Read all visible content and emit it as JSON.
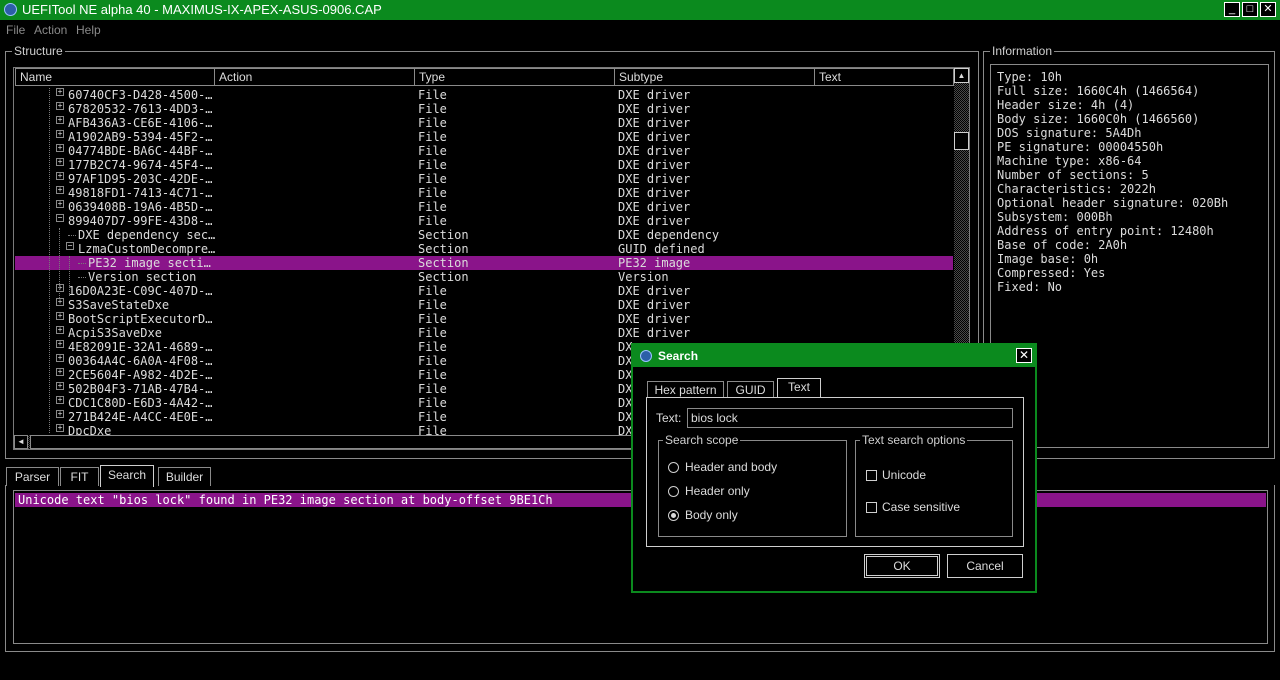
{
  "window": {
    "title": "UEFITool NE alpha 40 - MAXIMUS-IX-APEX-ASUS-0906.CAP",
    "minimize": "_",
    "maximize": "□",
    "close": "✕"
  },
  "menu": [
    "File",
    "Action",
    "Help"
  ],
  "structure": {
    "title": "Structure",
    "columns": [
      "Name",
      "Action",
      "Type",
      "Subtype",
      "Text"
    ],
    "rows": [
      {
        "name": "60740CF3-D428-4500-…",
        "type": "File",
        "subtype": "DXE driver",
        "level": 1,
        "expander": "+"
      },
      {
        "name": "67820532-7613-4DD3-…",
        "type": "File",
        "subtype": "DXE driver",
        "level": 1,
        "expander": "+"
      },
      {
        "name": "AFB436A3-CE6E-4106-…",
        "type": "File",
        "subtype": "DXE driver",
        "level": 1,
        "expander": "+"
      },
      {
        "name": "A1902AB9-5394-45F2-…",
        "type": "File",
        "subtype": "DXE driver",
        "level": 1,
        "expander": "+"
      },
      {
        "name": "04774BDE-BA6C-44BF-…",
        "type": "File",
        "subtype": "DXE driver",
        "level": 1,
        "expander": "+"
      },
      {
        "name": "177B2C74-9674-45F4-…",
        "type": "File",
        "subtype": "DXE driver",
        "level": 1,
        "expander": "+"
      },
      {
        "name": "97AF1D95-203C-42DE-…",
        "type": "File",
        "subtype": "DXE driver",
        "level": 1,
        "expander": "+"
      },
      {
        "name": "49818FD1-7413-4C71-…",
        "type": "File",
        "subtype": "DXE driver",
        "level": 1,
        "expander": "+"
      },
      {
        "name": "0639408B-19A6-4B5D-…",
        "type": "File",
        "subtype": "DXE driver",
        "level": 1,
        "expander": "+"
      },
      {
        "name": "899407D7-99FE-43D8-…",
        "type": "File",
        "subtype": "DXE driver",
        "level": 1,
        "expander": "-"
      },
      {
        "name": "DXE dependency sec…",
        "type": "Section",
        "subtype": "DXE dependency",
        "level": 2,
        "expander": ""
      },
      {
        "name": "LzmaCustomDecompre…",
        "type": "Section",
        "subtype": "GUID defined",
        "level": 2,
        "expander": "-"
      },
      {
        "name": "PE32 image secti…",
        "type": "Section",
        "subtype": "PE32 image",
        "level": 3,
        "expander": "",
        "selected": true
      },
      {
        "name": "Version section",
        "type": "Section",
        "subtype": "Version",
        "level": 3,
        "expander": ""
      },
      {
        "name": "16D0A23E-C09C-407D-…",
        "type": "File",
        "subtype": "DXE driver",
        "level": 1,
        "expander": "+"
      },
      {
        "name": "S3SaveStateDxe",
        "type": "File",
        "subtype": "DXE driver",
        "level": 1,
        "expander": "+"
      },
      {
        "name": "BootScriptExecutorD…",
        "type": "File",
        "subtype": "DXE driver",
        "level": 1,
        "expander": "+"
      },
      {
        "name": "AcpiS3SaveDxe",
        "type": "File",
        "subtype": "DXE driver",
        "level": 1,
        "expander": "+"
      },
      {
        "name": "4E82091E-32A1-4689-…",
        "type": "File",
        "subtype": "DX",
        "level": 1,
        "expander": "+"
      },
      {
        "name": "00364A4C-6A0A-4F08-…",
        "type": "File",
        "subtype": "DX",
        "level": 1,
        "expander": "+"
      },
      {
        "name": "2CE5604F-A982-4D2E-…",
        "type": "File",
        "subtype": "DX",
        "level": 1,
        "expander": "+"
      },
      {
        "name": "502B04F3-71AB-47B4-…",
        "type": "File",
        "subtype": "DX",
        "level": 1,
        "expander": "+"
      },
      {
        "name": "CDC1C80D-E6D3-4A42-…",
        "type": "File",
        "subtype": "DX",
        "level": 1,
        "expander": "+"
      },
      {
        "name": "271B424E-A4CC-4E0E-…",
        "type": "File",
        "subtype": "DX",
        "level": 1,
        "expander": "+"
      },
      {
        "name": "DpcDxe",
        "type": "File",
        "subtype": "DX",
        "level": 1,
        "expander": "+"
      }
    ],
    "scroll_up": "▲",
    "scroll_left": "◄"
  },
  "information": {
    "title": "Information",
    "lines": [
      "Type: 10h",
      "Full size: 1660C4h (1466564)",
      "Header size: 4h (4)",
      "Body size: 1660C0h (1466560)",
      "DOS signature: 5A4Dh",
      "PE signature: 00004550h",
      "Machine type: x86-64",
      "Number of sections: 5",
      "Characteristics: 2022h",
      "Optional header signature: 020Bh",
      "Subsystem: 000Bh",
      "Address of entry point: 12480h",
      "Base of code: 2A0h",
      "Image base: 0h",
      "Compressed: Yes",
      "Fixed: No"
    ]
  },
  "bottom_tabs": [
    "Parser",
    "FIT",
    "Search",
    "Builder"
  ],
  "messages": [
    "Unicode text \"bios lock\" found in PE32 image section at body-offset 9BE1Ch"
  ],
  "search_dialog": {
    "title": "Search",
    "close": "✕",
    "tabs": [
      "Hex pattern",
      "GUID",
      "Text"
    ],
    "text_label": "Text:",
    "text_value": "bios lock",
    "scope_title": "Search scope",
    "scope_options": [
      "Header and body",
      "Header only",
      "Body only"
    ],
    "scope_selected": "Body only",
    "options_title": "Text search options",
    "options": [
      {
        "label": "Unicode",
        "checked": false
      },
      {
        "label": "Case sensitive",
        "checked": false
      }
    ],
    "ok": "OK",
    "cancel": "Cancel"
  }
}
